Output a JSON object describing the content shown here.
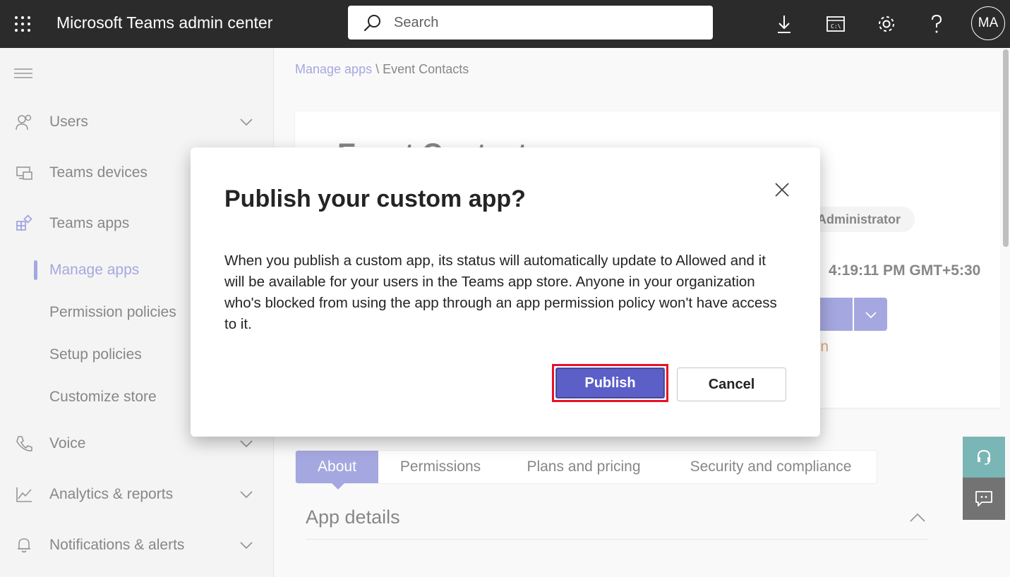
{
  "header": {
    "app_title": "Microsoft Teams admin center",
    "search_placeholder": "Search",
    "avatar_initials": "MA"
  },
  "sidebar": {
    "items": [
      {
        "label": "Users",
        "icon": "users-icon",
        "expandable": true
      },
      {
        "label": "Teams devices",
        "icon": "devices-icon",
        "expandable": false
      },
      {
        "label": "Teams apps",
        "icon": "apps-icon",
        "expandable": false
      },
      {
        "label": "Voice",
        "icon": "phone-icon",
        "expandable": true
      },
      {
        "label": "Analytics & reports",
        "icon": "chart-icon",
        "expandable": true
      },
      {
        "label": "Notifications & alerts",
        "icon": "bell-icon",
        "expandable": true
      }
    ],
    "subitems": [
      {
        "label": "Manage apps",
        "active": true
      },
      {
        "label": "Permission policies"
      },
      {
        "label": "Setup policies"
      },
      {
        "label": "Customize store"
      }
    ]
  },
  "breadcrumb": {
    "parent": "Manage apps",
    "separator": "\\",
    "current": "Event Contacts"
  },
  "app_card": {
    "title": "Event Contact",
    "role_badge": "Administrator",
    "timestamp": "4:19:11 PM GMT+5:30",
    "action_text": "action"
  },
  "tabs": [
    {
      "label": "About",
      "active": true
    },
    {
      "label": "Permissions"
    },
    {
      "label": "Plans and pricing"
    },
    {
      "label": "Security and compliance"
    }
  ],
  "section": {
    "title": "App details"
  },
  "dialog": {
    "title": "Publish your custom app?",
    "body": "When you publish a custom app, its status will automatically update to Allowed and it will be available for your users in the Teams app store. Anyone in your organization who's blocked from using the app through an app permission policy won't have access to it.",
    "primary_label": "Publish",
    "secondary_label": "Cancel"
  },
  "colors": {
    "brand": "#5b5fc7",
    "topbar": "#2b2b2b",
    "highlight": "#e81123",
    "help_button": "#0f7b7b",
    "warning": "#c4620b"
  }
}
